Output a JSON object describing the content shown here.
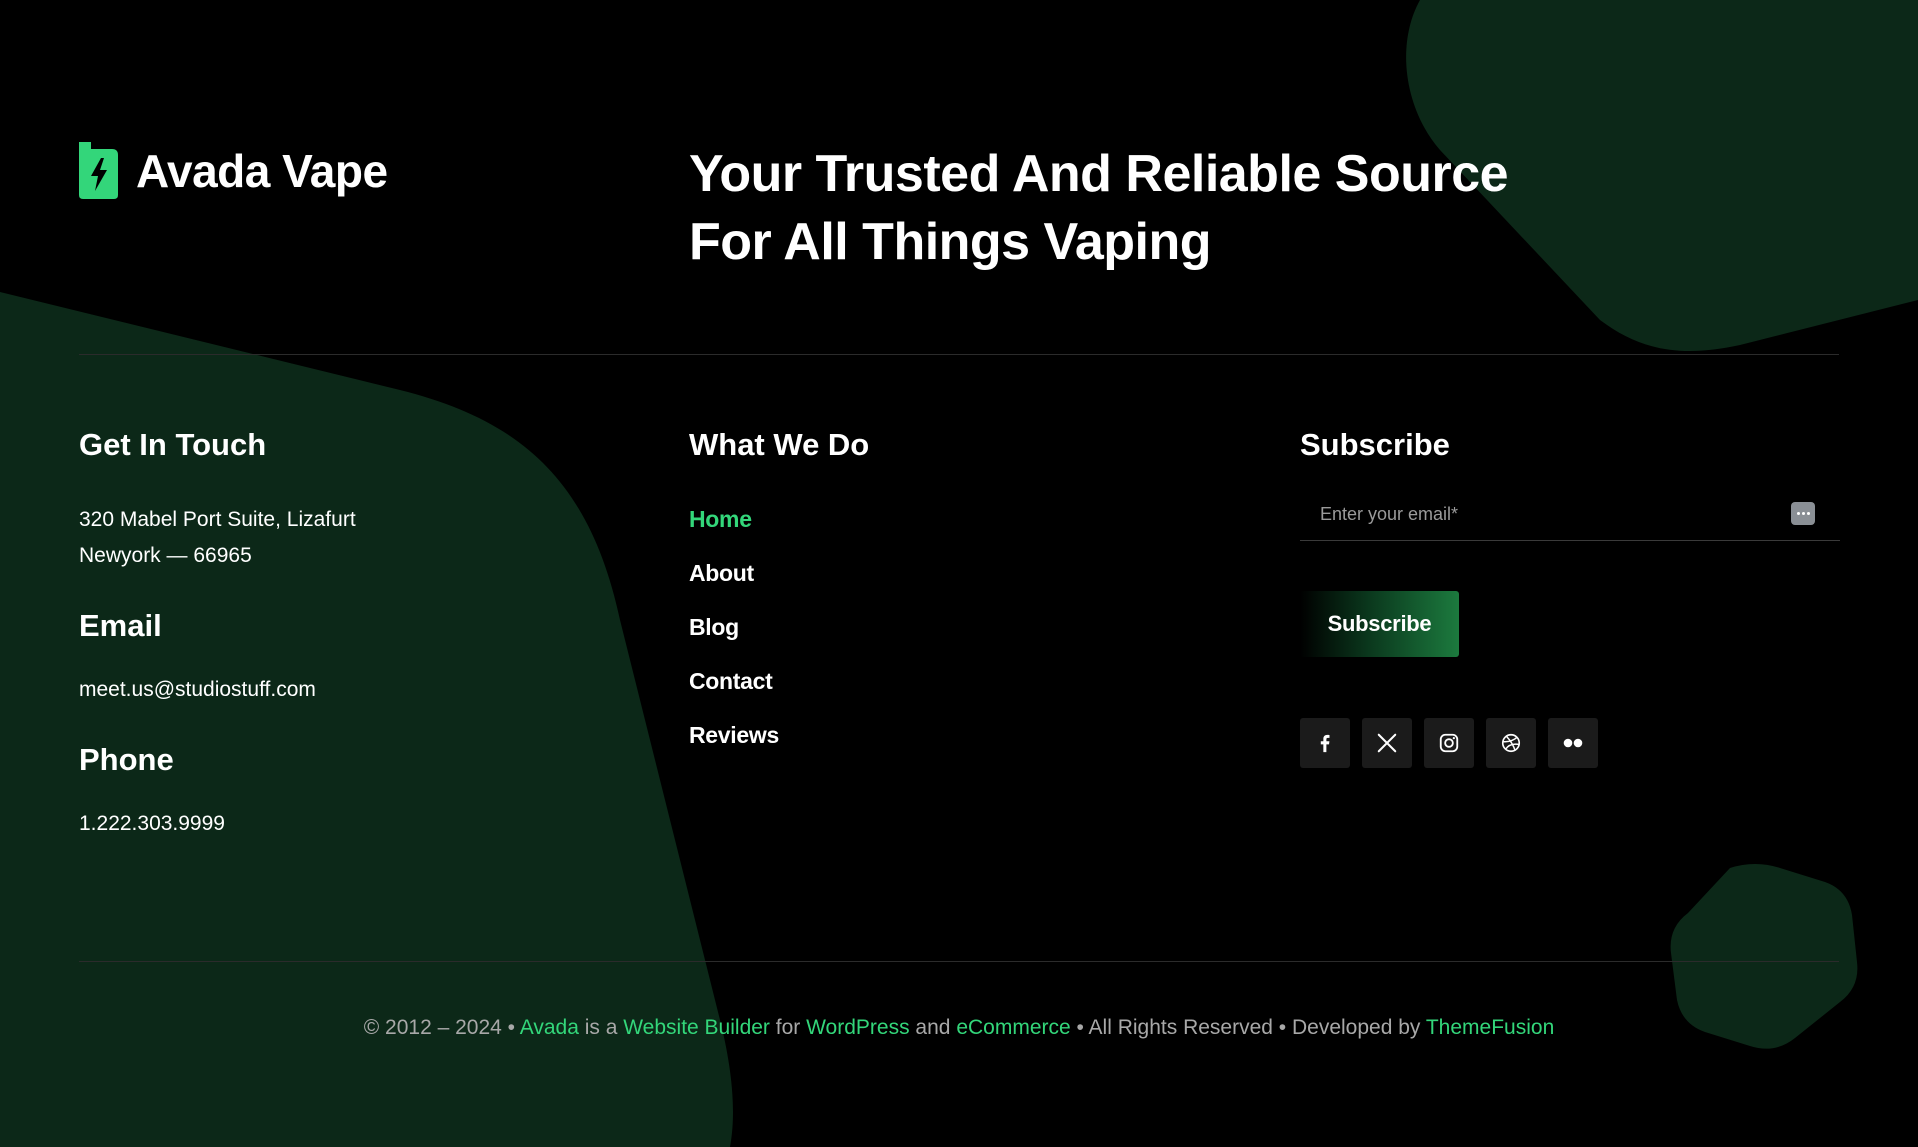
{
  "colors": {
    "background": "#000000",
    "accent": "#33d67a",
    "shape_green": "#0c2818",
    "muted_text": "#a8a8a8"
  },
  "brand": {
    "name": "Avada Vape",
    "icon": "battery-bolt-icon"
  },
  "tagline": "Your Trusted And Reliable Source For All Things Vaping",
  "contact": {
    "heading": "Get In Touch",
    "address_line1": "320 Mabel Port Suite, Lizafurt",
    "address_line2": "Newyork — 66965",
    "email_heading": "Email",
    "email": "meet.us@studiostuff.com",
    "phone_heading": "Phone",
    "phone": "1.222.303.9999"
  },
  "nav": {
    "heading": "What We Do",
    "items": [
      {
        "label": "Home",
        "active": true
      },
      {
        "label": "About",
        "active": false
      },
      {
        "label": "Blog",
        "active": false
      },
      {
        "label": "Contact",
        "active": false
      },
      {
        "label": "Reviews",
        "active": false
      }
    ]
  },
  "subscribe": {
    "heading": "Subscribe",
    "placeholder": "Enter your email*",
    "value": "",
    "button_label": "Subscribe",
    "field_icon": "password-manager-icon"
  },
  "socials": [
    {
      "name": "facebook-icon"
    },
    {
      "name": "x-twitter-icon"
    },
    {
      "name": "instagram-icon"
    },
    {
      "name": "dribbble-icon"
    },
    {
      "name": "flickr-icon"
    }
  ],
  "footer": {
    "prefix": "© 2012 – 2024 • ",
    "link_avada": "Avada",
    "text_is_a": " is a ",
    "link_builder": "Website Builder",
    "text_for": " for ",
    "link_wordpress": "WordPress",
    "text_and": " and ",
    "link_ecommerce": "eCommerce",
    "text_rights": " • All Rights Reserved • Developed by ",
    "link_themefusion": "ThemeFusion"
  }
}
